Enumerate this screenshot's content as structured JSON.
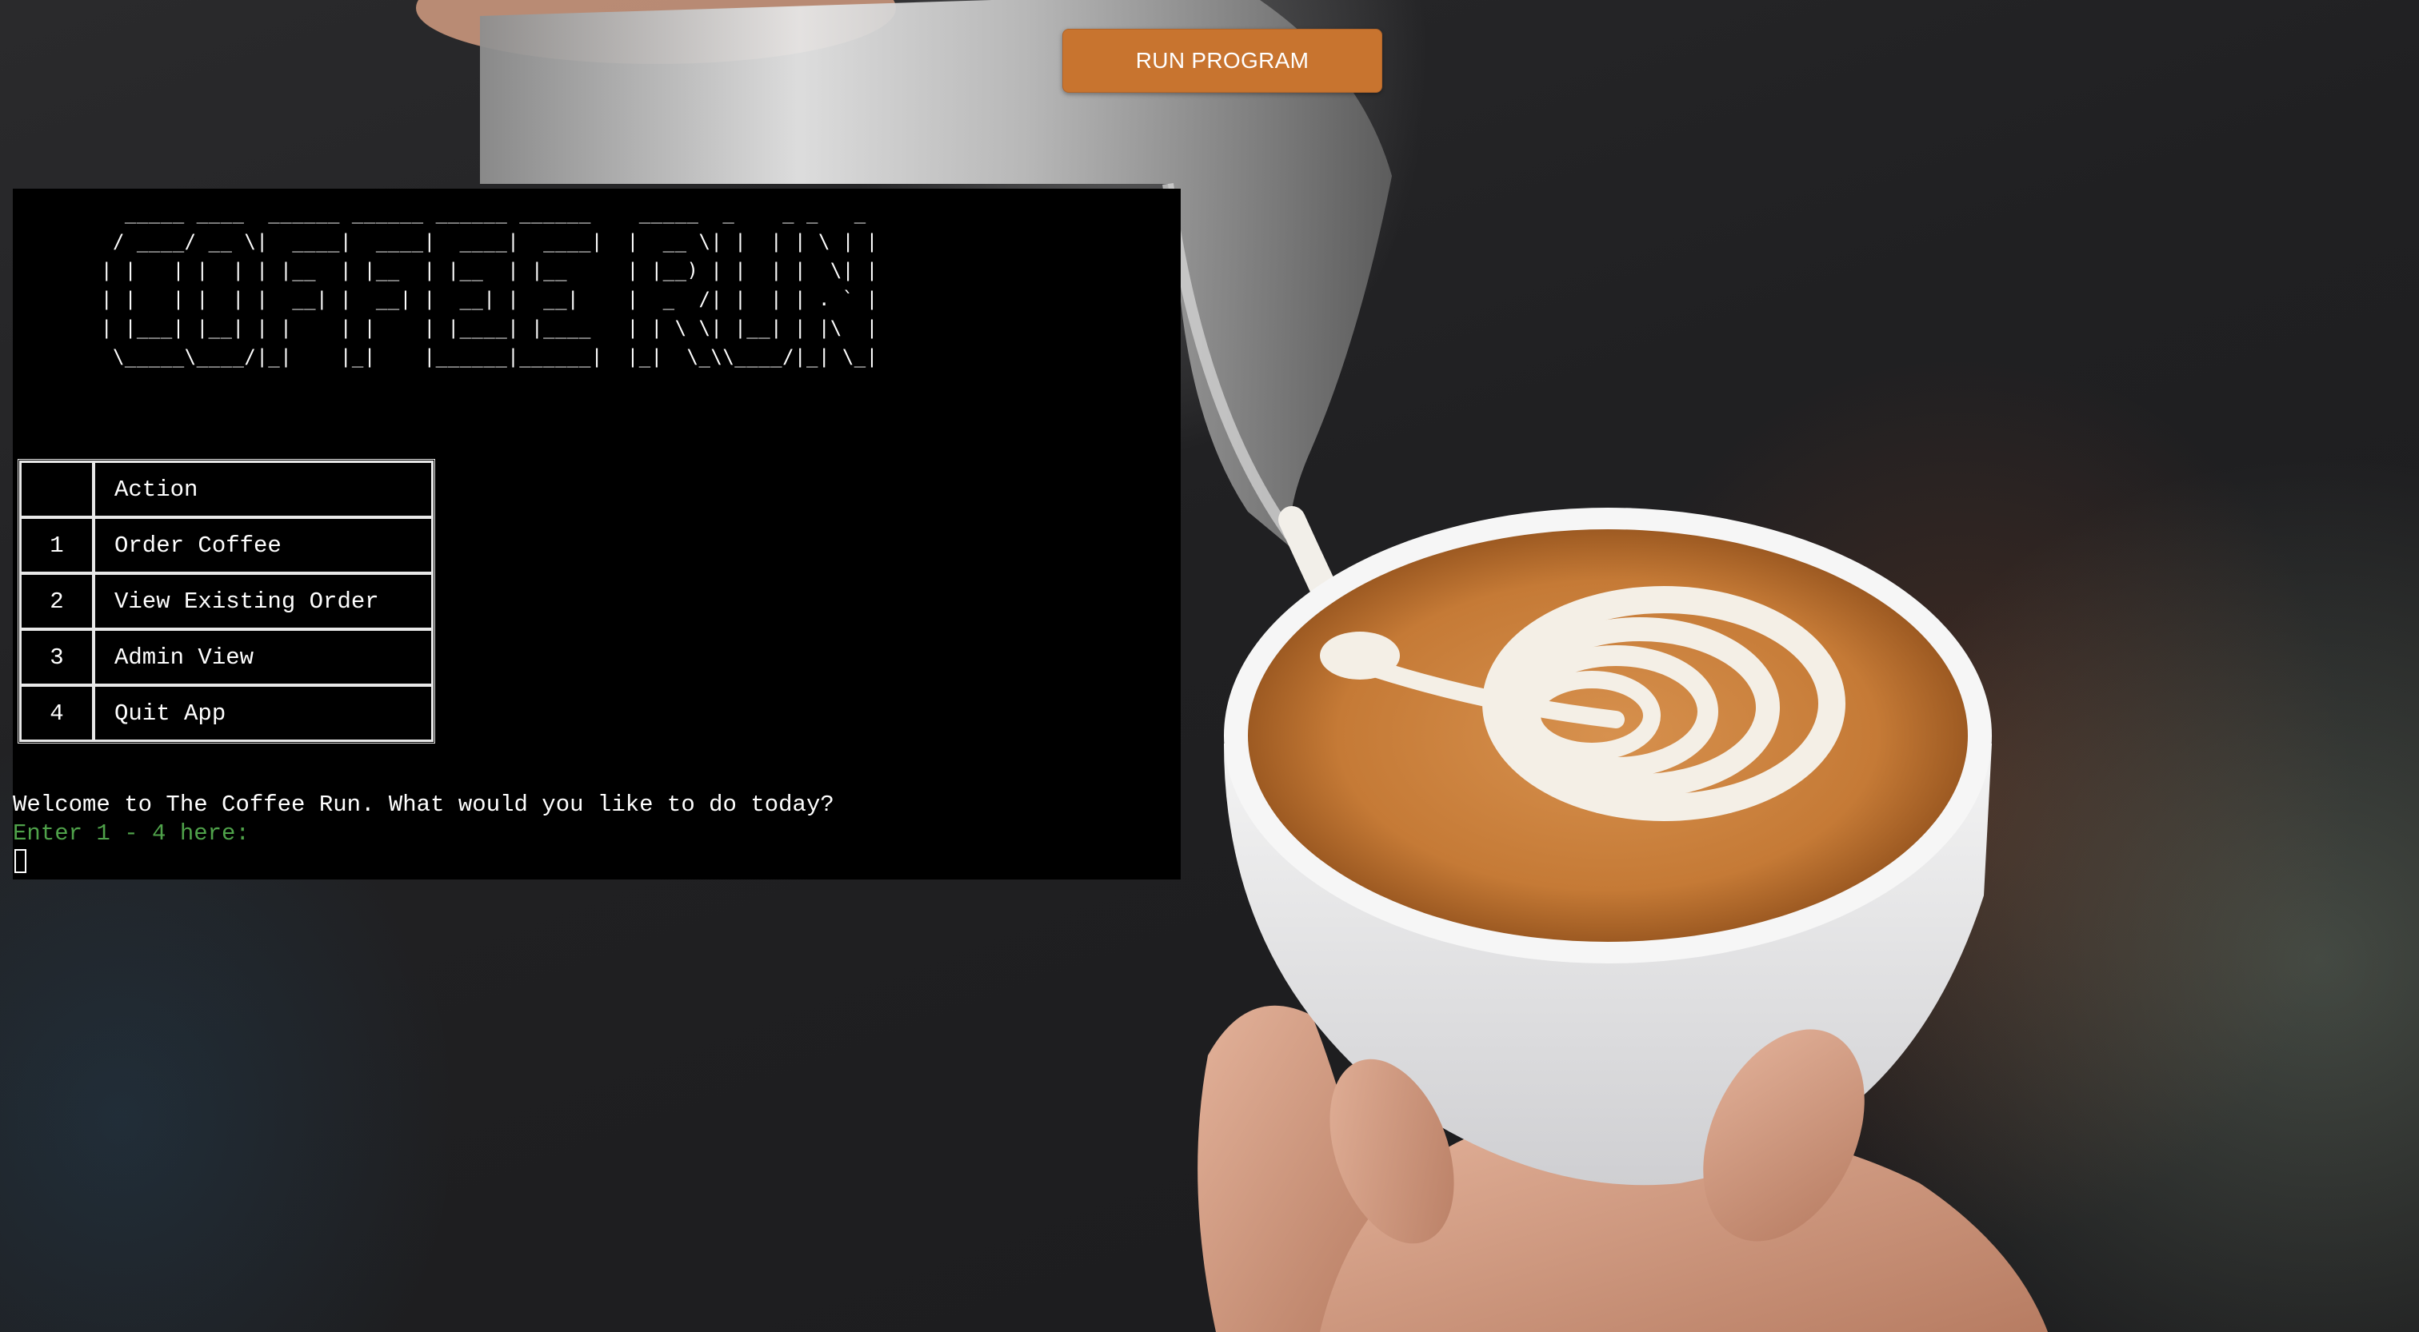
{
  "header": {
    "run_button_label": "RUN PROGRAM"
  },
  "terminal": {
    "ascii_title_lines": [
      "  _____ ____  ______ ______ ______ ______    _____  _    _ _   _ ",
      " / ____/ __ \\|  ____|  ____|  ____|  ____|  |  __ \\| |  | | \\ | |",
      "| |   | |  | | |__  | |__  | |__  | |__     | |__) | |  | |  \\| |",
      "| |   | |  | |  __| |  __| |  __| |  __|    |  _  /| |  | | . ` |",
      "| |___| |__| | |    | |    | |____| |____   | | \\ \\| |__| | |\\  |",
      " \\_____\\____/|_|    |_|    |______|______|  |_|  \\_\\\\____/|_| \\_|"
    ],
    "menu": {
      "header_num": "",
      "header_action": "Action",
      "rows": [
        {
          "num": "1",
          "action": "Order Coffee"
        },
        {
          "num": "2",
          "action": "View Existing Order"
        },
        {
          "num": "3",
          "action": "Admin View"
        },
        {
          "num": "4",
          "action": "Quit App"
        }
      ]
    },
    "welcome_text": "Welcome to The Coffee Run. What would you like to do today?",
    "prompt_text": "Enter 1 - 4 here:",
    "prompt_color": "#4fa24a"
  },
  "colors": {
    "button_bg": "#c8742f",
    "terminal_bg": "#000000",
    "terminal_text": "#ffffff"
  },
  "background": {
    "icon": "latte-art-photo"
  }
}
